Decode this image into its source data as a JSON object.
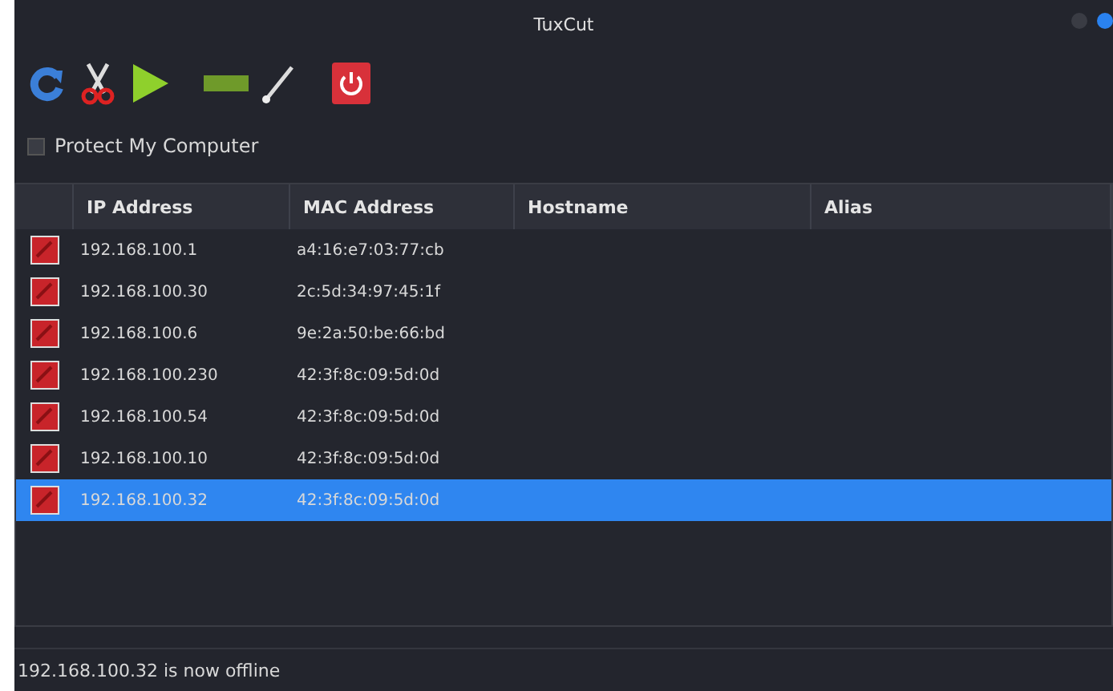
{
  "window": {
    "title": "TuxCut"
  },
  "protect": {
    "label": "Protect My Computer",
    "checked": false
  },
  "table": {
    "columns": [
      "IP Address",
      "MAC Address",
      "Hostname",
      "Alias"
    ],
    "rows": [
      {
        "ip": "192.168.100.1",
        "mac": "a4:16:e7:03:77:cb",
        "selected": false
      },
      {
        "ip": "192.168.100.30",
        "mac": "2c:5d:34:97:45:1f",
        "selected": false
      },
      {
        "ip": "192.168.100.6",
        "mac": "9e:2a:50:be:66:bd",
        "selected": false
      },
      {
        "ip": "192.168.100.230",
        "mac": "42:3f:8c:09:5d:0d",
        "selected": false
      },
      {
        "ip": "192.168.100.54",
        "mac": "42:3f:8c:09:5d:0d",
        "selected": false
      },
      {
        "ip": "192.168.100.10",
        "mac": "42:3f:8c:09:5d:0d",
        "selected": false
      },
      {
        "ip": "192.168.100.32",
        "mac": "42:3f:8c:09:5d:0d",
        "selected": true
      }
    ]
  },
  "status_bar": "192.168.100.32 is now offline"
}
